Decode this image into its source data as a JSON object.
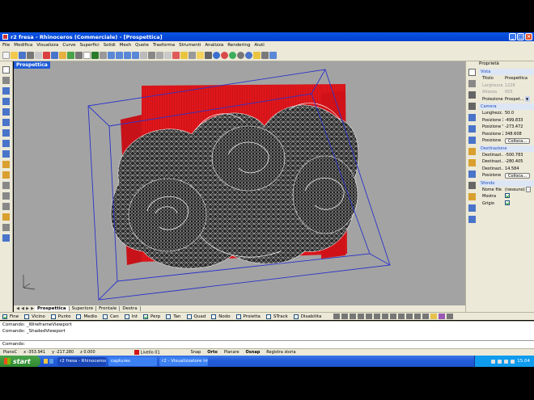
{
  "window": {
    "title": "r2 fresa - Rhinoceros (Commerciale) - [Prospettica]"
  },
  "menu": [
    "File",
    "Modifica",
    "Visualizza",
    "Curve",
    "Superfici",
    "Solidi",
    "Mesh",
    "Quote",
    "Trasforma",
    "Strumenti",
    "Analizza",
    "Rendering",
    "Aiuti"
  ],
  "viewport": {
    "title": "Prospettica",
    "tabs": [
      "Prospettica",
      "Superiore",
      "Frontale",
      "Destra"
    ]
  },
  "properties": {
    "header": "Proprietà",
    "vista_section": "Vista",
    "titolo_label": "Titolo",
    "titolo_value": "Prospettica",
    "larghezza_label": "Larghezza",
    "larghezza_value": "1228",
    "altezza_label": "Altezza",
    "altezza_value": "655",
    "proiezione_label": "Proiezione",
    "proiezione_value": "Prospet...",
    "camera_section": "Camera",
    "lunghezza_label": "Lunghezz...",
    "lunghezza_value": "50.0",
    "posx_label": "Posizione X",
    "posx_value": "-499.833",
    "posy_label": "Posizione Y",
    "posy_value": "-273.472",
    "posz_label": "Posizione Z",
    "posz_value": "348.608",
    "posizione_label": "Posizione",
    "colloca_label": "Colloca...",
    "destinazione_section": "Destinazione",
    "destx_label": "Destinazi...",
    "destx_value": "-500.783",
    "desty_label": "Destinazi...",
    "desty_value": "-280.405",
    "destz_label": "Destinazi...",
    "destz_value": "14.584",
    "posizione2_label": "Posizione",
    "colloca2_label": "Colloca...",
    "sfondo_section": "Sfondo",
    "nomefile_label": "Nome file",
    "nomefile_value": "(nessuno)",
    "mostra_label": "Mostra",
    "grigio_label": "Grigio"
  },
  "osnap": [
    {
      "label": "Fine",
      "checked": true
    },
    {
      "label": "Vicino",
      "checked": false
    },
    {
      "label": "Punto",
      "checked": false
    },
    {
      "label": "Medio",
      "checked": false
    },
    {
      "label": "Cen",
      "checked": false
    },
    {
      "label": "Int",
      "checked": false
    },
    {
      "label": "Perp",
      "checked": true
    },
    {
      "label": "Tan",
      "checked": false
    },
    {
      "label": "Quad",
      "checked": false
    },
    {
      "label": "Nodo",
      "checked": false
    },
    {
      "label": "Proietta",
      "checked": false
    },
    {
      "label": "STrack",
      "checked": false
    },
    {
      "label": "Disabilita",
      "checked": false
    }
  ],
  "command": {
    "history": [
      "Comando: _WireframeViewport",
      "Comando: _ShadedViewport"
    ],
    "prompt": "Comando:"
  },
  "status": {
    "cplane": "PianoC",
    "x": "x -353.941",
    "y": "y -217.280",
    "z": "z 0.000",
    "layer": "Livello 01",
    "layer_color": "#d21414",
    "snap": "Snap",
    "orto": "Orto",
    "planare": "Planare",
    "osnap": "Osnap",
    "registra": "Registra storia"
  },
  "taskbar": {
    "start": "start",
    "tasks": [
      "r2 fresa - Rhinoceros ...",
      "captures",
      "r2 - Visualizzatore im..."
    ],
    "clock": "15.04"
  }
}
